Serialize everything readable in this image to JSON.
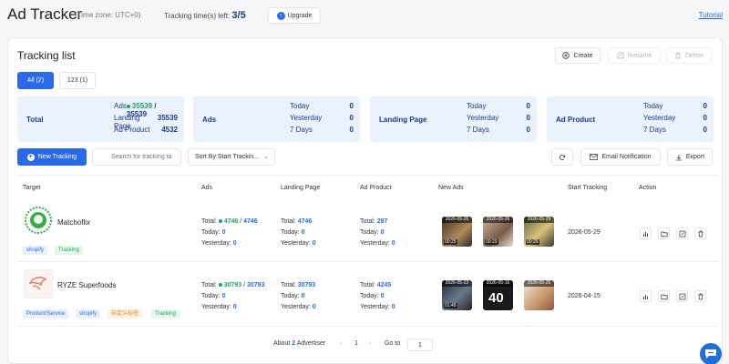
{
  "header": {
    "title": "Ad Tracker",
    "timezone": "(Time zone: UTC+0)",
    "tracking_left_label": "Tracking time(s) left:",
    "tracking_left_value": "3/5",
    "upgrade_label": "Upgrade",
    "tutorial_label": "Tutorial"
  },
  "panel": {
    "title": "Tracking list",
    "create_label": "Create",
    "rename_label": "Rename",
    "delete_label": "Delete",
    "tabs": [
      {
        "label": "All (2)",
        "active": true
      },
      {
        "label": "123 (1)",
        "active": false
      }
    ]
  },
  "summary": {
    "total": {
      "name": "Total",
      "ads_label": "Ads",
      "ads_active": "35539",
      "ads_sep": "/",
      "ads_total": "35539",
      "landing_label": "Landing Page",
      "landing_value": "35539",
      "product_label": "Ad Product",
      "product_value": "4532"
    },
    "ads": {
      "name": "Ads",
      "today_label": "Today",
      "today": "0",
      "yesterday_label": "Yesterday",
      "yesterday": "0",
      "days_label": "7 Days",
      "days": "0"
    },
    "landing": {
      "name": "Landing Page",
      "today_label": "Today",
      "today": "0",
      "yesterday_label": "Yesterday",
      "yesterday": "0",
      "days_label": "7 Days",
      "days": "0"
    },
    "product": {
      "name": "Ad Product",
      "today_label": "Today",
      "today": "0",
      "yesterday_label": "Yesterday",
      "yesterday": "0",
      "days_label": "7 Days",
      "days": "0"
    }
  },
  "toolbar": {
    "new_tracking_label": "New Tracking",
    "search_placeholder": "Search for tracking ta",
    "sort_label": "Sort By:Start Trackin...",
    "email_label": "Email Notification",
    "export_label": "Export"
  },
  "table": {
    "headers": [
      "Target",
      "Ads",
      "Landing Page",
      "Ad Product",
      "New Ads",
      "Start Tracking",
      "Action"
    ],
    "rows": [
      {
        "name": "Matchoflix",
        "tags": [
          "shopify",
          "Tracking"
        ],
        "ads_total_label": "Total:",
        "ads_active": "4746",
        "ads_total": "4746",
        "ads_today_label": "Today:",
        "ads_today": "0",
        "ads_yesterday_label": "Yesterday:",
        "ads_yesterday": "0",
        "lp_total": "4746",
        "lp_today": "0",
        "lp_yesterday": "0",
        "prod_total": "287",
        "prod_today": "0",
        "prod_yesterday": "0",
        "thumbs": [
          {
            "date": "2026-05-26",
            "duration": "00:25"
          },
          {
            "date": "2026-05-26",
            "duration": "00:29"
          },
          {
            "date": "2026-05-29",
            "duration": "00:29"
          }
        ],
        "start": "2026-05-29"
      },
      {
        "name": "RYZE Superfoods",
        "tags": [
          "Product/Service",
          "shopify",
          "自定义标签",
          "Tracking"
        ],
        "ads_total_label": "Total:",
        "ads_active": "30793",
        "ads_total": "30793",
        "ads_today_label": "Today:",
        "ads_today": "0",
        "ads_yesterday_label": "Yesterday:",
        "ads_yesterday": "0",
        "lp_total": "30793",
        "lp_today": "0",
        "lp_yesterday": "0",
        "prod_total": "4245",
        "prod_today": "0",
        "prod_yesterday": "0",
        "thumbs": [
          {
            "date": "2026-05-22",
            "duration": "01:49"
          },
          {
            "date": "2026-05-16",
            "duration": "40"
          },
          {
            "date": "2026-05-25",
            "duration": ""
          }
        ],
        "start": "2026-04-15"
      }
    ]
  },
  "pagination": {
    "about_label": "About",
    "count": "2",
    "unit": "Advertiser",
    "prev": "‹",
    "page": "1",
    "next": "›",
    "goto_label": "Go to",
    "goto_value": "1"
  },
  "colors": {
    "accent": "#2a6ae9",
    "green": "#1fa463",
    "card_bg": "#eaf2fd",
    "navy": "#1f3a8a"
  }
}
